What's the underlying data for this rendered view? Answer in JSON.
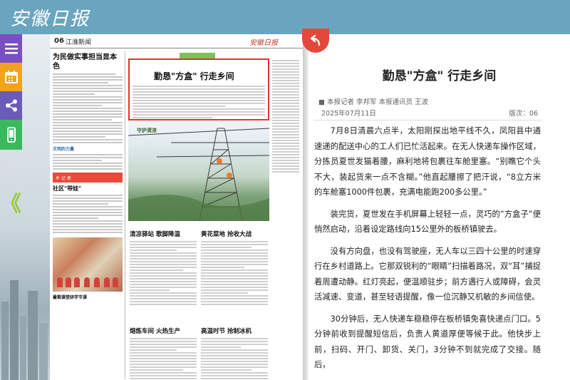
{
  "header": {
    "logo_text": "安徽日报"
  },
  "side_buttons": [
    {
      "name": "menu-icon"
    },
    {
      "name": "calendar-icon"
    },
    {
      "name": "share-icon"
    },
    {
      "name": "mobile-icon"
    }
  ],
  "nav": {
    "prev_page_glyph": "《"
  },
  "newspaper": {
    "page_number": "06",
    "section": "江淮新闻",
    "logo_small": "安徽日报",
    "left_column": {
      "headline": "为民做实事担当显本色",
      "subhead": "文明的力量",
      "banner": "乡 记 者",
      "headline2": "社区\"带娃\"",
      "photo_caption": "暑期课堂研学节课"
    },
    "highlight_title": "勤恳\"方盒\" 行走乡间",
    "photo_caption": "守护清凉",
    "sub_headlines": [
      "清凉驿站 歌脚降温",
      "黄花菜地 抢收大战",
      "熔炼车间 火热生产",
      "高温时节 抢制冰机"
    ]
  },
  "article": {
    "title": "勤恳\"方盒\" 行走乡间",
    "author": "■ 本报记者 李邦军 本报通讯员 王波",
    "date": "2025年07月11日",
    "edition": "版次：06",
    "paragraphs": [
      "7月8日清晨六点半，太阳刚探出地平线不久，凤阳县中通速递的配送中心的工人们已忙活起来。在无人快递车操作区域，分拣员夏世发猫着腰，麻利地将包裹往车舱里塞。“别瞧它个头不大，装起货来一点不含糊。”他直起腰擦了把汗说，“8立方米的车舱塞1000件包裹，充满电能跑200多公里。”",
      "装完货，夏世发在手机屏幕上轻轻一点，灵巧的“方盒子”便悄然启动，沿着设定路线向15公里外的板桥镇驶去。",
      "没有方向盘，也没有驾驶座，无人车以三四十公里的时速穿行在乡村道路上。它那双锐利的“眼睛”扫描着路况，双“耳”捕捉着周遭动静。红灯亮起，便温顺驻步；前方遇行人或障碍，会灵活减速、变道，甚至轻语提醒，像一位沉静又机敏的乡间信使。",
      "30分钟后，无人快递车稳稳停在板桥镇免喜快递点门口。5分钟前收到提醒短信后，负责人黄道厚便等候于此。他快步上前，扫码、开门、卸货、关门，3分钟不到就完成了交接。随后，"
    ]
  },
  "colors": {
    "header_band": "#6aa5c0",
    "highlight_border": "#e53030",
    "back_button": "#e2493a",
    "menu_button": "#7b4fc2",
    "calendar_button": "#f2a31b",
    "share_button": "#6a5bb8",
    "mobile_button": "#3bb85b"
  }
}
